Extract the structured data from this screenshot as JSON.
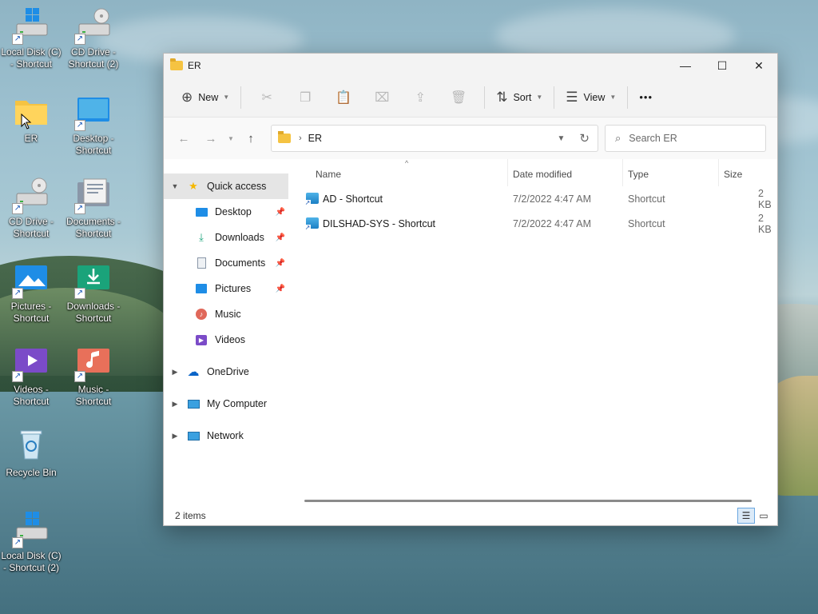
{
  "desktop": {
    "icons": [
      {
        "label": "Local Disk (C) - Shortcut",
        "kind": "drive"
      },
      {
        "label": "CD Drive - Shortcut (2)",
        "kind": "cd"
      },
      {
        "label": "ER",
        "kind": "folder"
      },
      {
        "label": "Desktop - Shortcut",
        "kind": "desktop"
      },
      {
        "label": "CD Drive - Shortcut",
        "kind": "cd"
      },
      {
        "label": "Documents - Shortcut",
        "kind": "documents"
      },
      {
        "label": "Pictures - Shortcut",
        "kind": "pictures"
      },
      {
        "label": "Downloads - Shortcut",
        "kind": "downloads"
      },
      {
        "label": "Videos - Shortcut",
        "kind": "videos"
      },
      {
        "label": "Music - Shortcut",
        "kind": "music"
      },
      {
        "label": "Recycle Bin",
        "kind": "recycle"
      },
      {
        "label": "Local Disk (C) - Shortcut (2)",
        "kind": "drive"
      }
    ]
  },
  "window": {
    "title": "ER",
    "controls": {
      "minimize": "—",
      "maximize": "☐",
      "close": "✕"
    }
  },
  "toolbar": {
    "new_label": "New",
    "sort_label": "Sort",
    "view_label": "View",
    "more_label": "•••"
  },
  "address": {
    "path": "ER",
    "search_placeholder": "Search ER"
  },
  "navpane": {
    "quick_access": "Quick access",
    "items": [
      {
        "label": "Desktop",
        "icon": "desktop-icon",
        "pinned": true
      },
      {
        "label": "Downloads",
        "icon": "downloads-icon",
        "pinned": true
      },
      {
        "label": "Documents",
        "icon": "documents-icon",
        "pinned": true
      },
      {
        "label": "Pictures",
        "icon": "pictures-icon",
        "pinned": true
      },
      {
        "label": "Music",
        "icon": "music-icon",
        "pinned": false
      },
      {
        "label": "Videos",
        "icon": "videos-icon",
        "pinned": false
      }
    ],
    "onedrive": "OneDrive",
    "my_computer": "My Computer",
    "network": "Network"
  },
  "columns": {
    "name": "Name",
    "date": "Date modified",
    "type": "Type",
    "size": "Size"
  },
  "files": [
    {
      "name": "AD - Shortcut",
      "date": "7/2/2022 4:47 AM",
      "type": "Shortcut",
      "size": "2 KB"
    },
    {
      "name": "DILSHAD-SYS - Shortcut",
      "date": "7/2/2022 4:47 AM",
      "type": "Shortcut",
      "size": "2 KB"
    }
  ],
  "status": {
    "count": "2 items"
  },
  "colors": {
    "folder": "#f5c342",
    "accent": "#0a64c8",
    "selected_bg": "#e5e5e5"
  }
}
